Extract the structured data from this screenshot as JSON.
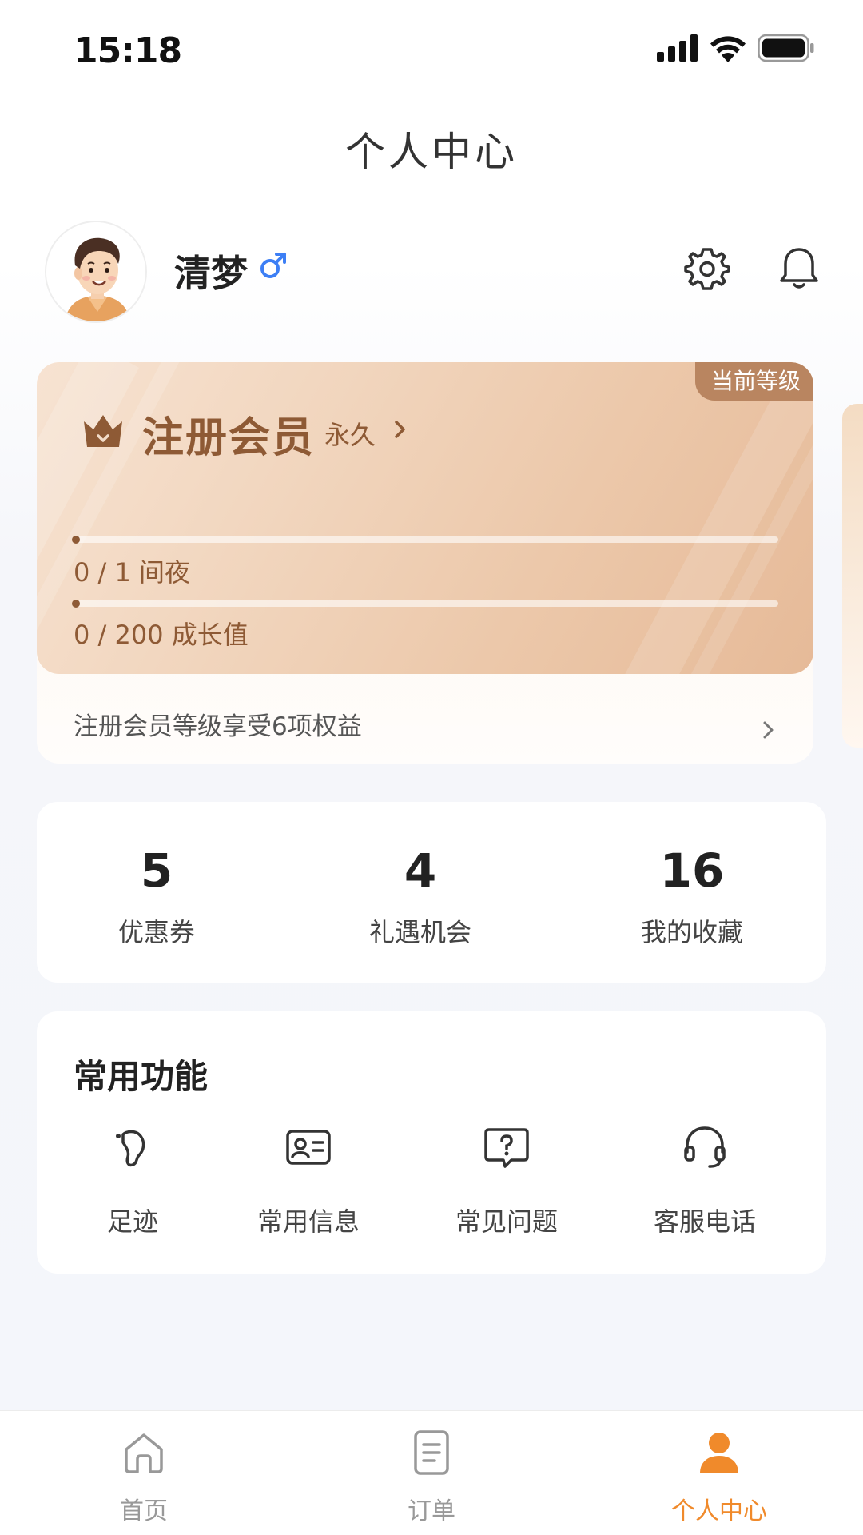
{
  "status_bar": {
    "time": "15:18"
  },
  "header": {
    "title": "个人中心"
  },
  "profile": {
    "name": "清梦",
    "gender_icon": "male-icon"
  },
  "membership": {
    "badge": "当前等级",
    "level_name": "注册会员",
    "duration": "永久",
    "progress": [
      {
        "text": "0 / 1 间夜",
        "fraction": 0
      },
      {
        "text": "0 / 200 成长值",
        "fraction": 0
      }
    ],
    "benefits_text": "注册会员等级享受6项权益"
  },
  "stats": [
    {
      "value": "5",
      "label": "优惠券"
    },
    {
      "value": "4",
      "label": "礼遇机会"
    },
    {
      "value": "16",
      "label": "我的收藏"
    }
  ],
  "functions": {
    "title": "常用功能",
    "items": [
      {
        "label": "足迹",
        "icon": "footprint-icon"
      },
      {
        "label": "常用信息",
        "icon": "id-card-icon"
      },
      {
        "label": "常见问题",
        "icon": "question-bubble-icon"
      },
      {
        "label": "客服电话",
        "icon": "headset-icon"
      }
    ]
  },
  "tabs": [
    {
      "label": "首页",
      "icon": "home-icon",
      "active": false
    },
    {
      "label": "订单",
      "icon": "order-icon",
      "active": false
    },
    {
      "label": "个人中心",
      "icon": "user-icon",
      "active": true
    }
  ],
  "colors": {
    "accent": "#f08a2b",
    "member_text": "#8e5a35",
    "member_badge": "#b98560",
    "gender_blue": "#3d7ff5"
  }
}
